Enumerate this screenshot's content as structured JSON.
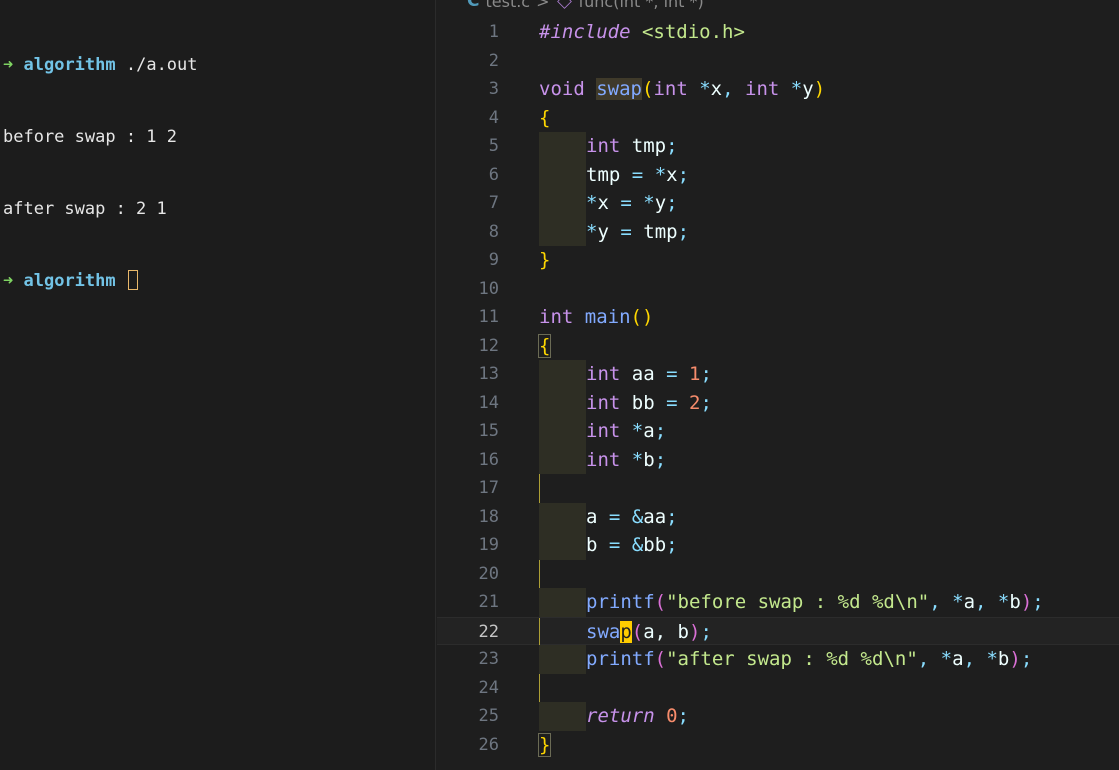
{
  "terminal": {
    "lines": [
      {
        "arrow": "➜",
        "dir": "algorithm",
        "cmd": " ./a.out"
      },
      {
        "text": "before swap : 1 2"
      },
      {
        "text": "after swap : 2 1"
      },
      {
        "arrow": "➜",
        "dir": "algorithm",
        "cmd": ""
      }
    ]
  },
  "editor": {
    "breadcrumb": {
      "file_icon": "C",
      "file": "test.c",
      "separator": ">",
      "symbol_icon": "cube-icon",
      "symbol": "func(int *, int *)"
    },
    "current_line": 22,
    "line_numbers": [
      "1",
      "2",
      "3",
      "4",
      "5",
      "6",
      "7",
      "8",
      "9",
      "10",
      "11",
      "12",
      "13",
      "14",
      "15",
      "16",
      "17",
      "18",
      "19",
      "20",
      "21",
      "22",
      "23",
      "24",
      "25",
      "26"
    ],
    "code": {
      "l1": [
        "#include",
        " ",
        "<stdio.h>"
      ],
      "l3": [
        "void",
        " ",
        "swap",
        "(",
        "int",
        " ",
        "*",
        "x",
        ", ",
        "int",
        " ",
        "*",
        "y",
        ")"
      ],
      "l4": [
        "{"
      ],
      "l5": [
        "int",
        " tmp",
        ";"
      ],
      "l6": [
        "tmp",
        " ",
        "=",
        " ",
        "*",
        "x",
        ";"
      ],
      "l7": [
        "*",
        "x",
        " ",
        "=",
        " ",
        "*",
        "y",
        ";"
      ],
      "l8": [
        "*",
        "y",
        " ",
        "=",
        " ",
        "tmp",
        ";"
      ],
      "l9": [
        "}"
      ],
      "l11": [
        "int",
        " ",
        "main",
        "()"
      ],
      "l12": [
        "{"
      ],
      "l13": [
        "int",
        " aa ",
        "=",
        " ",
        "1",
        ";"
      ],
      "l14": [
        "int",
        " bb ",
        "=",
        " ",
        "2",
        ";"
      ],
      "l15": [
        "int",
        " ",
        "*",
        "a",
        ";"
      ],
      "l16": [
        "int",
        " ",
        "*",
        "b",
        ";"
      ],
      "l18": [
        "a",
        " ",
        "=",
        " ",
        "&",
        "aa",
        ";"
      ],
      "l19": [
        "b",
        " ",
        "=",
        " ",
        "&",
        "bb",
        ";"
      ],
      "l21": [
        "printf",
        "(",
        "\"before swap : %d %d",
        "\\n",
        "\"",
        ", ",
        "*",
        "a",
        ", ",
        "*",
        "b",
        ")",
        ";"
      ],
      "l22": [
        "swa",
        "p",
        "(",
        "a, b",
        ")",
        ";"
      ],
      "l23": [
        "printf",
        "(",
        "\"after swap : %d %d",
        "\\n",
        "\"",
        ", ",
        "*",
        "a",
        ", ",
        "*",
        "b",
        ")",
        ";"
      ],
      "l25": [
        "return",
        " ",
        "0",
        ";"
      ],
      "l26": [
        "}"
      ]
    }
  },
  "colors": {
    "terminal_bg": "#1c1c1c",
    "editor_bg": "#1e1e1e",
    "prompt_arrow": "#7fd462",
    "prompt_dir": "#72c3e6",
    "keyword": "#c792ea",
    "function": "#82aaff",
    "string": "#c3e88d",
    "number": "#f78c6c",
    "bracket": "#ffd700"
  }
}
